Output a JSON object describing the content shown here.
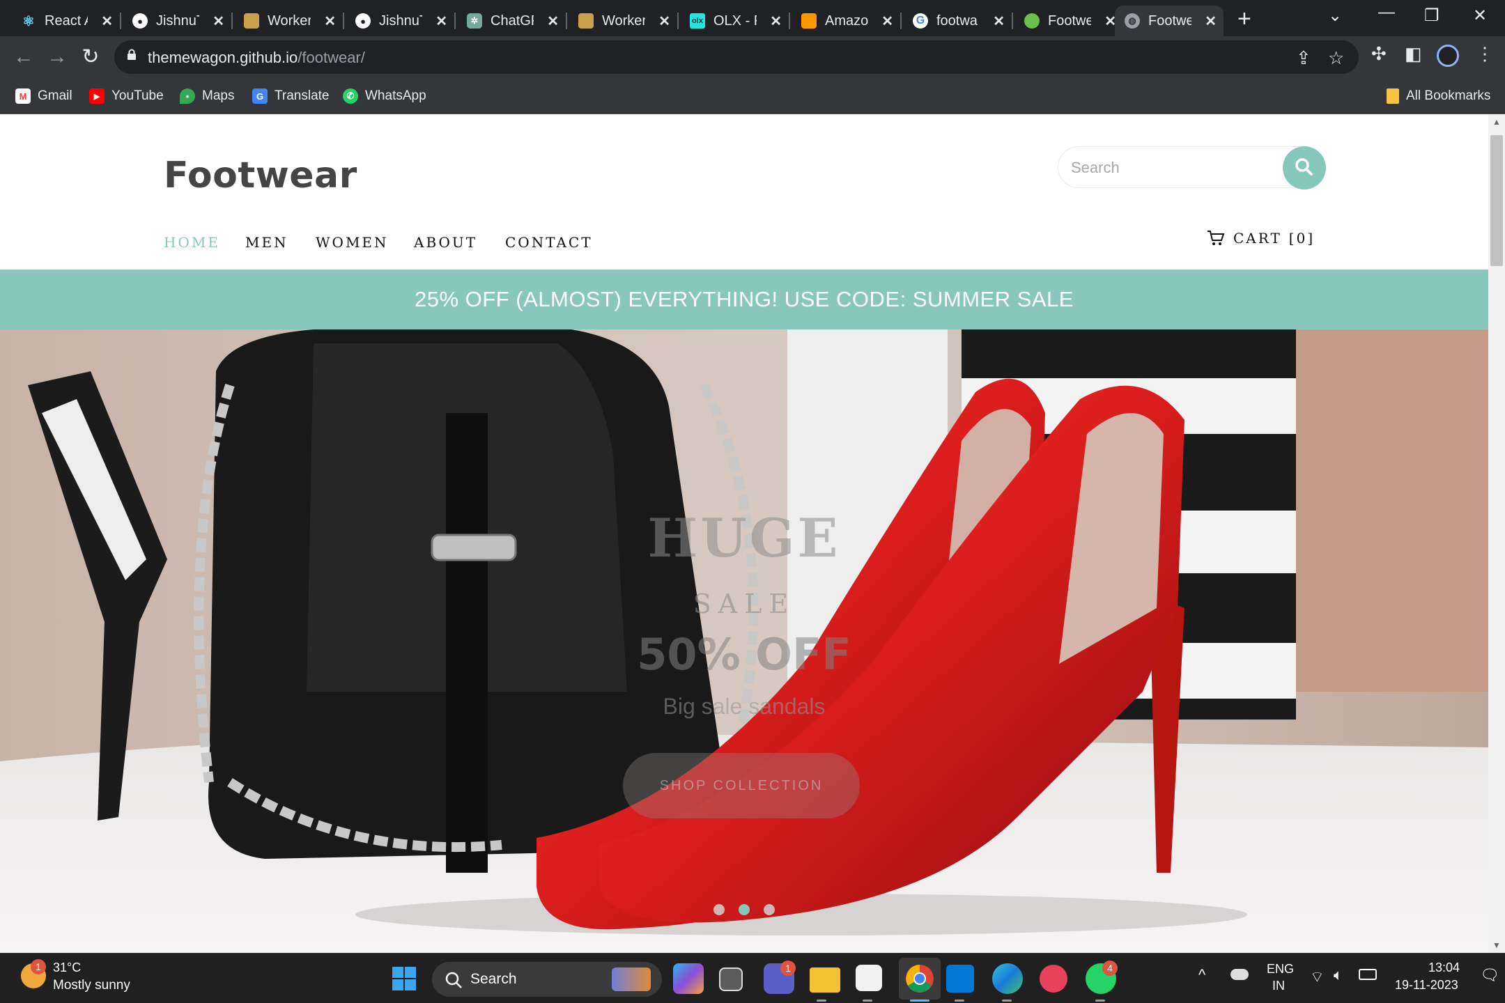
{
  "browser": {
    "tabs": [
      {
        "title": "React A",
        "icon": "react-icon",
        "color": "#61dafb"
      },
      {
        "title": "JishnuT",
        "icon": "github-icon",
        "color": "#ffffff"
      },
      {
        "title": "Worker",
        "icon": "worker-icon",
        "color": "#c9a04a"
      },
      {
        "title": "JishnuT",
        "icon": "github-icon",
        "color": "#ffffff"
      },
      {
        "title": "ChatGP",
        "icon": "chatgpt-icon",
        "color": "#74aa9c"
      },
      {
        "title": "Worker",
        "icon": "worker-icon",
        "color": "#c9a04a"
      },
      {
        "title": "OLX - F",
        "icon": "olx-icon",
        "color": "#23e5db"
      },
      {
        "title": "Amazo",
        "icon": "amazon-icon",
        "color": "#ff9900"
      },
      {
        "title": "footwa",
        "icon": "google-icon",
        "color": "#4285f4"
      },
      {
        "title": "Footwe",
        "icon": "footwear-green-icon",
        "color": "#6cc04a"
      },
      {
        "title": "Footwe",
        "icon": "globe-icon",
        "color": "#9aa0a6",
        "active": true
      }
    ],
    "close_glyph": "✕",
    "new_tab_glyph": "+",
    "address": {
      "host": "themewagon.github.io",
      "path": "/footwear/"
    },
    "bookmarks": [
      {
        "label": "Gmail",
        "icon": "gmail-icon",
        "color": "#ea4335"
      },
      {
        "label": "YouTube",
        "icon": "youtube-icon",
        "color": "#ff0000"
      },
      {
        "label": "Maps",
        "icon": "maps-icon",
        "color": "#34a853"
      },
      {
        "label": "Translate",
        "icon": "translate-icon",
        "color": "#4285f4"
      },
      {
        "label": "WhatsApp",
        "icon": "whatsapp-icon",
        "color": "#25d366"
      }
    ],
    "all_bookmarks": "All Bookmarks"
  },
  "site": {
    "brand": "Footwear",
    "search_placeholder": "Search",
    "nav": [
      "HOME",
      "MEN",
      "WOMEN",
      "ABOUT",
      "CONTACT"
    ],
    "active_nav": "HOME",
    "cart_label": "CART",
    "cart_count": "[0]",
    "promo": "25% OFF (ALMOST) EVERYTHING! USE CODE: SUMMER SALE",
    "hero": {
      "title": "HUGE",
      "subtitle": "SALE",
      "offer": "50% OFF",
      "description": "Big sale sandals",
      "button": "SHOP COLLECTION",
      "slides": 3,
      "active_slide": 2
    },
    "accent_color": "#88c8bc"
  },
  "taskbar": {
    "weather_temp": "31°C",
    "weather_desc": "Mostly sunny",
    "weather_badge": "1",
    "search_label": "Search",
    "teams_badge": "1",
    "whatsapp_badge": "4",
    "lang_top": "ENG",
    "lang_bottom": "IN",
    "time": "13:04",
    "date": "19-11-2023"
  }
}
